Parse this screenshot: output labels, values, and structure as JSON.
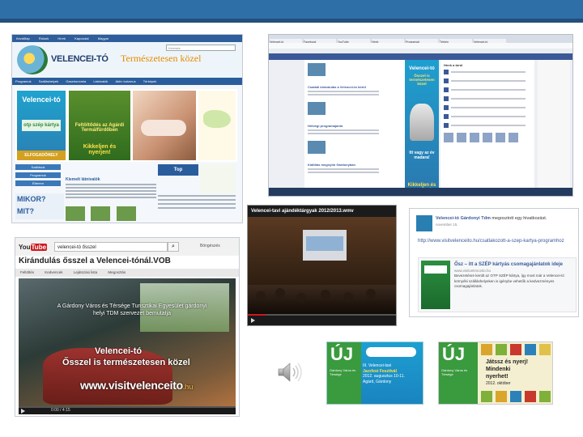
{
  "colors": {
    "top_bar": "#2f6fa8",
    "youtube_red": "#cc181e",
    "facebook_blue": "#3b5998",
    "brand_green": "#3a9a3e",
    "brand_orange": "#e68a00"
  },
  "website": {
    "nav_items": [
      "Kezdőlap",
      "Rólunk",
      "Hírek",
      "Kapcsolat",
      "Magyar"
    ],
    "search_label": "Keresés",
    "logo_text": "VELENCEI-TÓ",
    "tagline": "Természetesen közel",
    "menu_items": [
      "Programok",
      "Szálláshelyek",
      "Gasztronómia",
      "Látnivalók",
      "Aktív turizmus",
      "Térképek"
    ],
    "banner": {
      "velencei_title": "Velencei-tó",
      "otp_label": "otp szép kártya",
      "elfogadohely": "ELFOGADÓHELY",
      "feltoltodes_title": "Feltöltődés az Agárdi Termálfürdőben",
      "feltoltodes_sub": "Kikkeljen és nyerjen!"
    },
    "side_buttons": [
      "Szállások",
      "Programok",
      "Étterem"
    ],
    "mikor": "MIKOR?",
    "mit": "MIT?",
    "ad_top": "Top",
    "news_title": "Kiemelt látnivalók"
  },
  "facebook": {
    "tabs": [
      "Velencei-tó",
      "Facebook",
      "YouTube",
      "Hírek",
      "Programok",
      "Térkép",
      "Velencei-tó"
    ],
    "ad": {
      "title": "Velencei-tó",
      "subtitle": "Ősszel is természetesen közel",
      "heron_text": "Itt vagy az év madara!",
      "cta": "Kikkeljen és nyerjen!"
    },
    "posts": [
      {
        "title": "Családi kirándulás a Velencei-tó körül"
      },
      {
        "title": "Hétvégi programajánló"
      },
      {
        "title": "Kiállítás megnyitó Gárdonyban"
      }
    ],
    "right_header": "Hírek a tóról"
  },
  "youtube1": {
    "logo_you": "You",
    "logo_tube": "Tube",
    "search_value": "velencei-tó ősszel",
    "browse": "Böngészés",
    "title": "Kirándulás ősszel a Velencei-tónál.VOB",
    "tabs": [
      "Feltöltés",
      "Kedvencek",
      "Lejátszási lista",
      "Megosztás"
    ],
    "caption": "A Gárdony Város és Térsége Turisztikai Egyesület gárdonyi helyi TDM szervezet bemutatja",
    "overlay_line1": "Velencei-tó",
    "overlay_line2": "Ősszel is természetesen közel",
    "url_main": "www.visitvelenceito",
    "url_suffix": ".hu",
    "time": "0:00 / 4:15",
    "progress": 0.0
  },
  "youtube2": {
    "title": "Velencei-tavi ajándéktárgyak 2012/2013.wmv",
    "progress": 0.12
  },
  "fbpost": {
    "name": "Velencei-tó Gárdonyi Tdm",
    "action": "megosztott egy hivatkozást.",
    "date": "november 15.",
    "link": "http://www.visitvelenceito.hu/csatlakozott-a-szep-kartya-programhoz",
    "card_title": "Ősz – itt a SZÉP kártyás csomagajánlatok ideje",
    "card_url": "www.visitvelenceito.hu",
    "card_desc": "Bevezetésre került az OTP SZÉP kártya, így most már a Velencei-tó környéki szálláshelyeken is igénybe vehetők a kedvezményes csomagajánlatok."
  },
  "uj_ad1": {
    "title": "ÚJ",
    "tagline": "Gárdony Város és Térsége",
    "text_line1": "III. Velencei-tavi",
    "text_line2": "Jazzfest Fesztivál",
    "text_line3": "2012. augusztus 10-11.",
    "text_line4": "Agárd, Gárdony"
  },
  "uj_ad2": {
    "title": "ÚJ",
    "tagline": "Gárdony Város és Térsége",
    "line1": "Játssz és nyerj!",
    "line2": "Mindenki",
    "line3": "nyerhet!",
    "date": "2012. október"
  }
}
